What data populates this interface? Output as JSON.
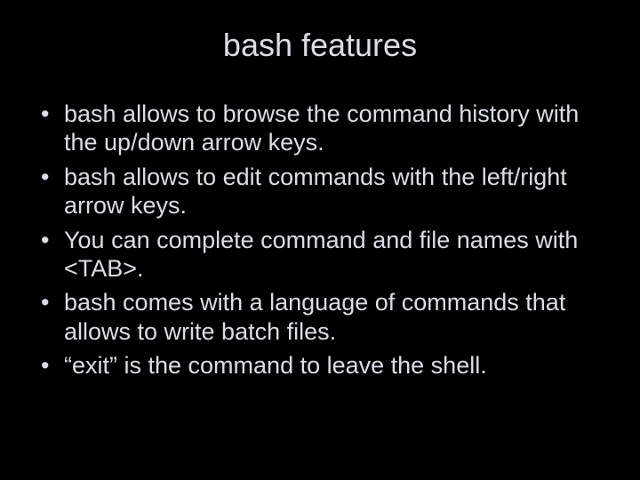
{
  "slide": {
    "title": "bash features",
    "bullets": [
      "bash allows to browse the command history with the up/down arrow keys.",
      "bash allows to edit commands with the left/right arrow keys.",
      "You can complete command and file names with <TAB>.",
      "bash comes with a language of commands that allows to write batch files.",
      "“exit” is the command to leave the shell."
    ]
  }
}
